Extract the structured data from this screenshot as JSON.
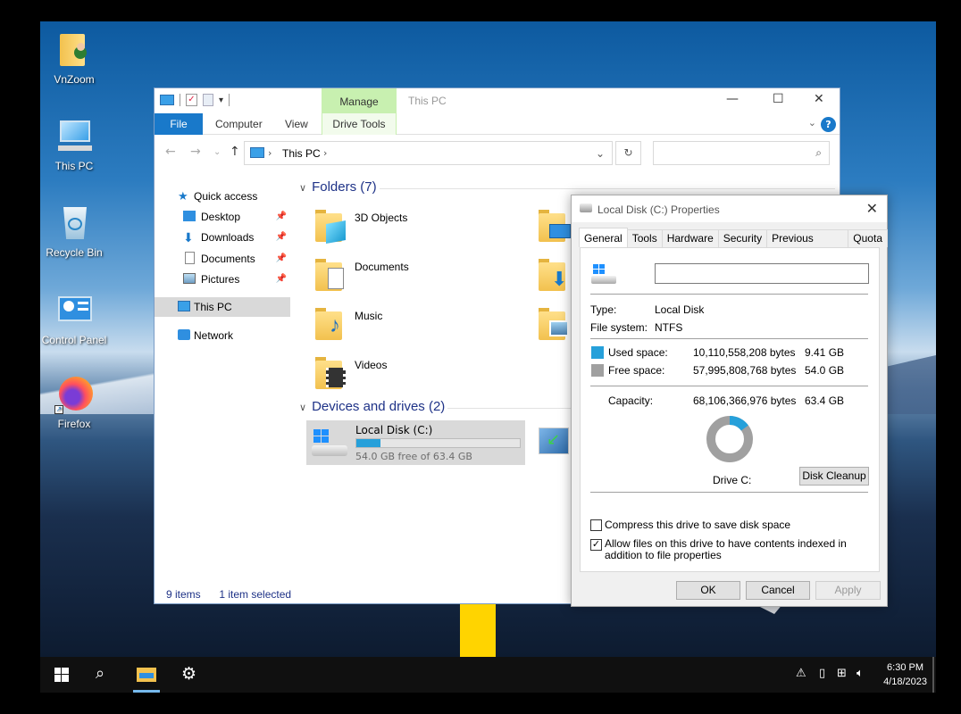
{
  "desktop": {
    "icons": [
      {
        "label": "VnZoom",
        "icon": "folder-user-icon"
      },
      {
        "label": "This PC",
        "icon": "computer-icon"
      },
      {
        "label": "Recycle Bin",
        "icon": "recycle-bin-icon"
      },
      {
        "label": "Control Panel",
        "icon": "control-panel-icon"
      },
      {
        "label": "Firefox",
        "icon": "firefox-icon"
      }
    ]
  },
  "explorer": {
    "title": "This PC",
    "context_tab": "Manage",
    "ribbon_tabs": [
      "File",
      "Computer",
      "View",
      "Drive Tools"
    ],
    "address": {
      "crumb": "This PC",
      "search_placeholder": ""
    },
    "nav": {
      "quick_access": "Quick access",
      "pinned": [
        "Desktop",
        "Downloads",
        "Documents",
        "Pictures"
      ],
      "this_pc": "This PC",
      "network": "Network"
    },
    "folders_header": "Folders (7)",
    "folders": [
      "3D Objects",
      "Documents",
      "Music",
      "Videos"
    ],
    "drives_header": "Devices and drives (2)",
    "drive": {
      "label": "Local Disk (C:)",
      "free_text": "54.0 GB free of 63.4 GB",
      "used_fraction": 0.148
    },
    "status": {
      "items": "9 items",
      "selected": "1 item selected"
    }
  },
  "properties": {
    "title": "Local Disk (C:) Properties",
    "tabs": [
      "General",
      "Tools",
      "Hardware",
      "Security",
      "Previous Versions",
      "Quota"
    ],
    "active_tab": "General",
    "name_value": "",
    "type_label": "Type:",
    "type_value": "Local Disk",
    "fs_label": "File system:",
    "fs_value": "NTFS",
    "used_label": "Used space:",
    "used_bytes": "10,110,558,208 bytes",
    "used_gb": "9.41 GB",
    "free_label": "Free space:",
    "free_bytes": "57,995,808,768 bytes",
    "free_gb": "54.0 GB",
    "capacity_label": "Capacity:",
    "capacity_bytes": "68,106,366,976 bytes",
    "capacity_gb": "63.4 GB",
    "drive_label": "Drive C:",
    "cleanup_button": "Disk Cleanup",
    "compress_label": "Compress this drive to save disk space",
    "compress_checked": false,
    "index_label": "Allow files on this drive to have contents indexed in addition to file properties",
    "index_checked": true,
    "ok": "OK",
    "cancel": "Cancel",
    "apply": "Apply",
    "colors": {
      "used": "#26a0da",
      "free": "#a0a0a0"
    }
  },
  "taskbar": {
    "time": "6:30 PM",
    "date": "4/18/2023"
  }
}
